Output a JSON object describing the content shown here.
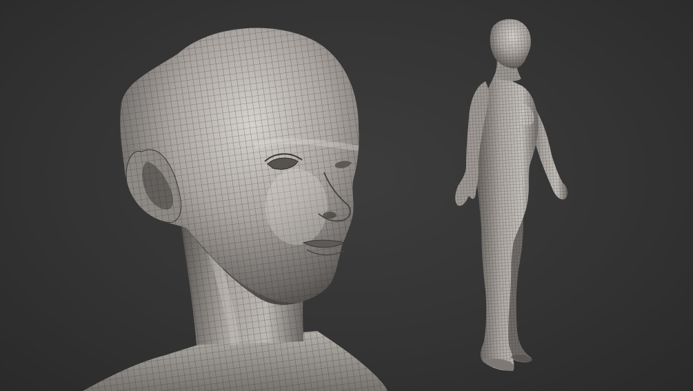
{
  "scene": {
    "subject": "wireframe-mesh-render",
    "background_color": "#353535",
    "mesh_base_color": "#a9a4a0",
    "mesh_highlight_color": "#d8d4d0",
    "mesh_shadow_color": "#4a4745",
    "wire_color": "#2b2927"
  },
  "views": [
    {
      "id": "head-closeup"
    },
    {
      "id": "full-body"
    }
  ]
}
